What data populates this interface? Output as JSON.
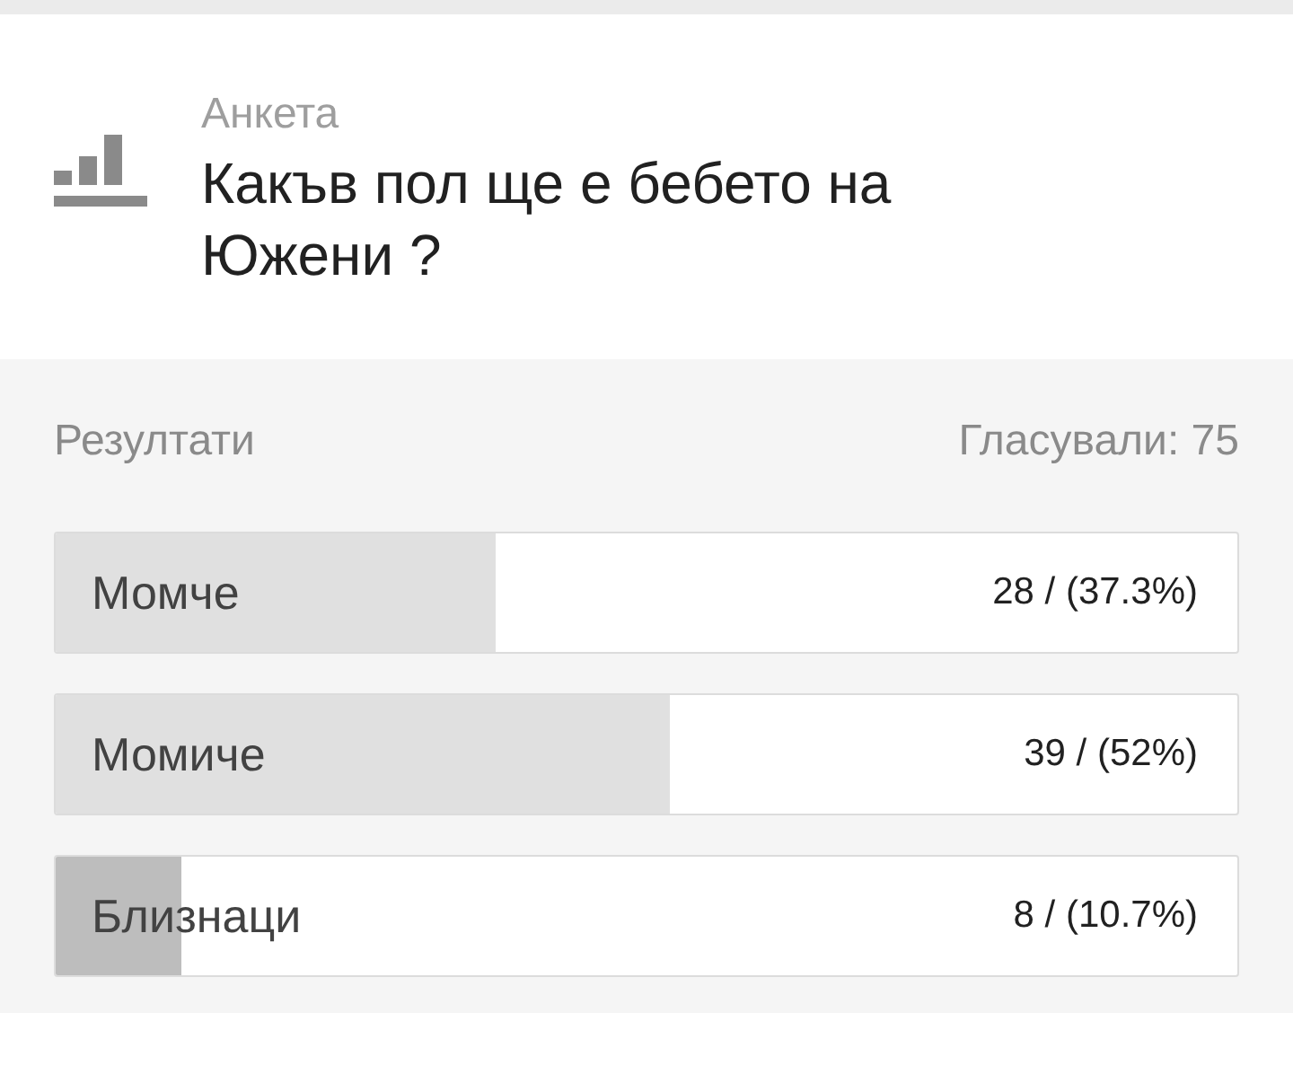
{
  "poll": {
    "label": "Анкета",
    "question": "Какъв пол ще е бебето на Южени ?"
  },
  "results": {
    "title": "Резултати",
    "votes": "Гласували: 75",
    "options": [
      {
        "label": "Момче",
        "reading": "28 / (37.3%)",
        "level": 0.373,
        "color": "#e0e0e0"
      },
      {
        "label": "Момиче",
        "reading": "39 / (52%)",
        "level": 0.52,
        "color": "#e0e0e0"
      },
      {
        "label": "Близнаци",
        "reading": "8 / (10.7%)",
        "level": 0.107,
        "color": "#bdbdbd"
      }
    ]
  }
}
